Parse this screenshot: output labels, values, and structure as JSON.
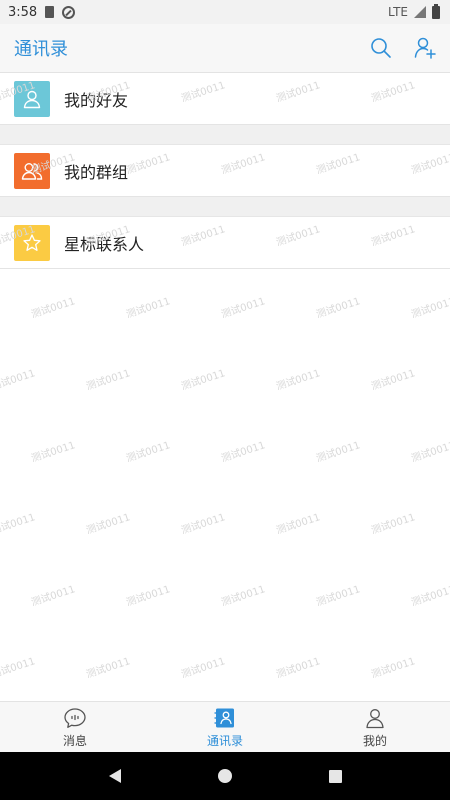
{
  "status_bar": {
    "time": "3:58",
    "network": "LTE"
  },
  "header": {
    "title": "通讯录",
    "icons": [
      "search-icon",
      "add-contact-icon"
    ]
  },
  "contacts_menu": [
    {
      "label": "我的好友",
      "icon": "person-icon",
      "color": "#6cc7d8"
    },
    {
      "label": "我的群组",
      "icon": "group-icon",
      "color": "#f26d2d"
    },
    {
      "label": "星标联系人",
      "icon": "star-icon",
      "color": "#fbcb43"
    }
  ],
  "watermark": "测试0011",
  "bottom_nav": [
    {
      "label": "消息",
      "icon": "chat-bubble-icon",
      "active": false
    },
    {
      "label": "通讯录",
      "icon": "contacts-book-icon",
      "active": true
    },
    {
      "label": "我的",
      "icon": "profile-icon",
      "active": false
    }
  ],
  "colors": {
    "accent": "#2f8fd8"
  }
}
